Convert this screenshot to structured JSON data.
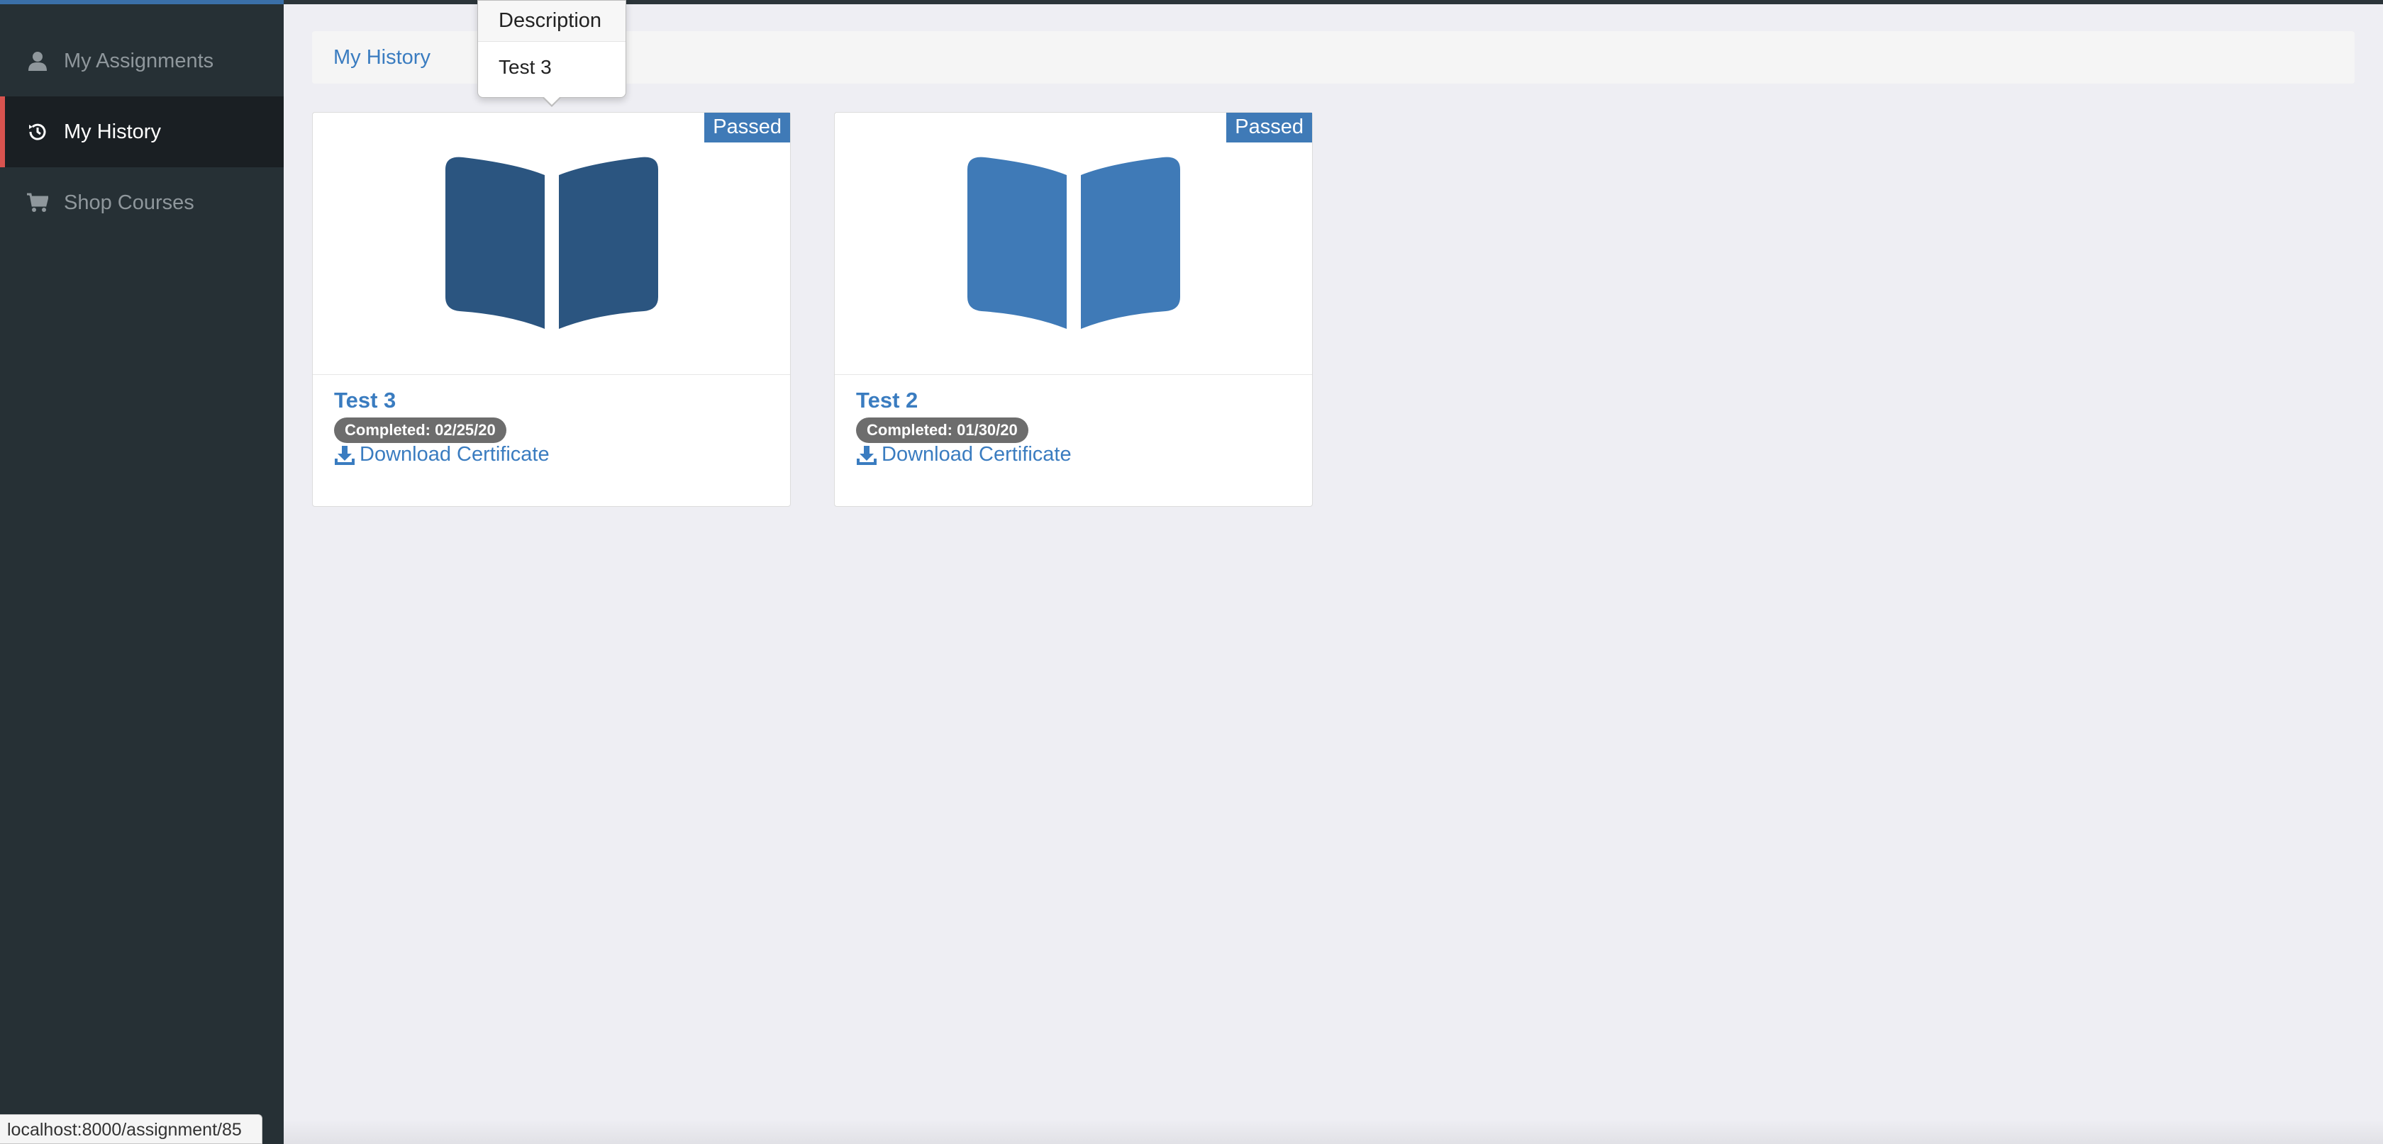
{
  "sidebar": {
    "items": [
      {
        "label": "My Assignments",
        "icon": "user-icon"
      },
      {
        "label": "My History",
        "icon": "history-icon",
        "active": true
      },
      {
        "label": "Shop Courses",
        "icon": "cart-icon"
      }
    ]
  },
  "breadcrumb": {
    "label": "My History"
  },
  "popover": {
    "title": "Description",
    "body": "Test 3"
  },
  "cards": [
    {
      "status": "Passed",
      "title": "Test 3",
      "completed": "Completed: 02/25/20",
      "download_label": "Download Certificate",
      "icon": "book-icon",
      "icon_color": "#2b5580"
    },
    {
      "status": "Passed",
      "title": "Test 2",
      "completed": "Completed: 01/30/20",
      "download_label": "Download Certificate",
      "icon": "book-icon",
      "icon_color": "#3f7ab7"
    }
  ],
  "status_bar": {
    "url": "localhost:8000/assignment/85"
  },
  "colors": {
    "accent": "#3a7cc0",
    "active_marker": "#d9534f",
    "sidebar_bg": "#263035"
  }
}
